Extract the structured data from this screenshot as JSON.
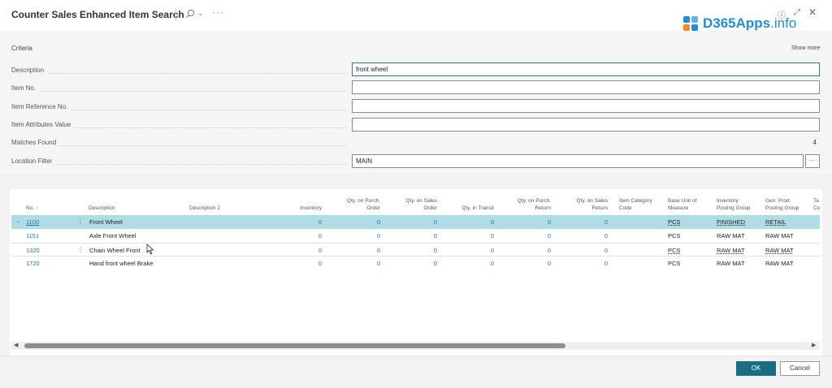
{
  "window": {
    "title": "Counter Sales Enhanced Item Search",
    "more_glyph": "···",
    "info_glyph": "ⓘ",
    "expand_glyph": "⤢",
    "close_glyph": "✕"
  },
  "logo": {
    "brand": "D365Apps",
    "suffix": ".info",
    "icon": "d365apps-logo"
  },
  "criteria": {
    "title": "Criteria",
    "show_more": "Show more",
    "fields": {
      "description": {
        "label": "Description",
        "value": "front wheel"
      },
      "item_no": {
        "label": "Item No.",
        "value": ""
      },
      "item_ref_no": {
        "label": "Item Reference No.",
        "value": ""
      },
      "item_attr": {
        "label": "Item Attributes Value",
        "value": ""
      },
      "matches": {
        "label": "Matches Found",
        "value": "4"
      },
      "location": {
        "label": "Location Filter",
        "value": "MAIN",
        "assist": "···"
      }
    }
  },
  "grid": {
    "headers": {
      "no": "No. ↑",
      "description": "Description",
      "description2": "Description 2",
      "inventory": "Inventory",
      "qty_purch_order": [
        "Qty. on Purch.",
        "Order"
      ],
      "qty_sales_order": [
        "Qty. on Sales",
        "Order"
      ],
      "qty_transit": "Qty. in Transit",
      "qty_purch_return": [
        "Qty. on Purch.",
        "Return"
      ],
      "qty_sales_return": [
        "Qty. on Sales",
        "Return"
      ],
      "item_category": [
        "Item Category",
        "Code"
      ],
      "base_uom": [
        "Base Unit of",
        "Measure"
      ],
      "inv_posting": [
        "Inventory",
        "Posting Group"
      ],
      "gen_prod": [
        "Gen. Prod.",
        "Posting Group"
      ],
      "tax": [
        "Ta",
        "Co"
      ]
    },
    "rows": [
      {
        "no": "1100",
        "description": "Front Wheel",
        "inventory": "0",
        "qpo": "0",
        "qso": "0",
        "qit": "0",
        "qpr": "0",
        "qsr": "0",
        "uom": "PCS",
        "inv_group": "FINISHED",
        "gen_group": "RETAIL"
      },
      {
        "no": "1151",
        "description": "Axle Front Wheel",
        "inventory": "0",
        "qpo": "0",
        "qso": "0",
        "qit": "0",
        "qpr": "0",
        "qsr": "0",
        "uom": "PCS",
        "inv_group": "RAW MAT",
        "gen_group": "RAW MAT"
      },
      {
        "no": "1320",
        "description": "Chain Wheel Front",
        "inventory": "0",
        "qpo": "0",
        "qso": "0",
        "qit": "0",
        "qpr": "0",
        "qsr": "0",
        "uom": "PCS",
        "inv_group": "RAW MAT",
        "gen_group": "RAW MAT"
      },
      {
        "no": "1720",
        "description": "Hand front wheel Brake",
        "inventory": "0",
        "qpo": "0",
        "qso": "0",
        "qit": "0",
        "qpr": "0",
        "qsr": "0",
        "uom": "PCS",
        "inv_group": "RAW MAT",
        "gen_group": "RAW MAT"
      }
    ],
    "row_arrow": "→",
    "row_menu": "⋮",
    "scroll_left": "◀",
    "scroll_right": "▶"
  },
  "footer": {
    "ok": "OK",
    "cancel": "Cancel"
  },
  "colors": {
    "accent": "#1a6e82",
    "link": "#1f7a99",
    "selected_row": "#aedde6",
    "logo": "#1e8fd6"
  }
}
